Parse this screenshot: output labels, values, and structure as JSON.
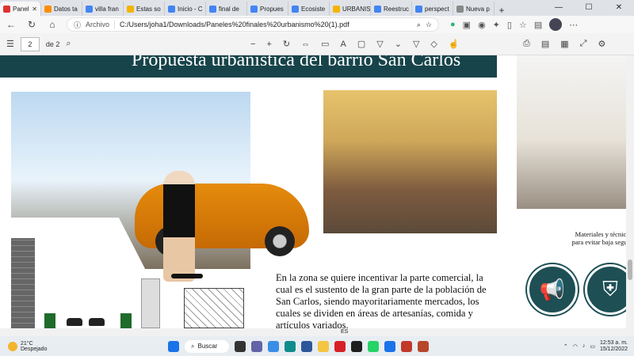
{
  "browser": {
    "tabs": [
      {
        "label": "Panel",
        "color": "#d33",
        "active": true
      },
      {
        "label": "Datos ta",
        "color": "#ff8c00"
      },
      {
        "label": "villa fran",
        "color": "#4285f4"
      },
      {
        "label": "Estas so",
        "color": "#f4b400"
      },
      {
        "label": "Inicio - C",
        "color": "#4285f4"
      },
      {
        "label": "final de",
        "color": "#4285f4"
      },
      {
        "label": "Propues",
        "color": "#4285f4"
      },
      {
        "label": "Ecosiste",
        "color": "#4285f4"
      },
      {
        "label": "URBANIS",
        "color": "#f4b400"
      },
      {
        "label": "Reestruc",
        "color": "#4285f4"
      },
      {
        "label": "perspect",
        "color": "#4285f4"
      },
      {
        "label": "Nueva p",
        "color": "#888"
      }
    ],
    "address_scheme": "Archivo",
    "url": "C:/Users/joha1/Downloads/Paneles%20finales%20urbanismo%20(1).pdf"
  },
  "pdf_toolbar": {
    "current_page": "2",
    "total_pages": "de 2"
  },
  "document": {
    "banner_title": "Propuesta urbanística del barrio San Carlos",
    "body_text": "En la zona se quiere incentivar la parte comercial, la cual es el sustento de la gran parte de la población de San Carlos, siendo mayoritariamente mercados, los cuales se dividen en áreas de artesanías, comida y artículos variados.",
    "side_note": "Materiales y técnic para evitar baja segur"
  },
  "taskbar": {
    "temperature": "21°C",
    "weather": "Despejado",
    "search_label": "Buscar",
    "language": "ES",
    "time": "12:53 a. m.",
    "date": "15/12/2022"
  }
}
